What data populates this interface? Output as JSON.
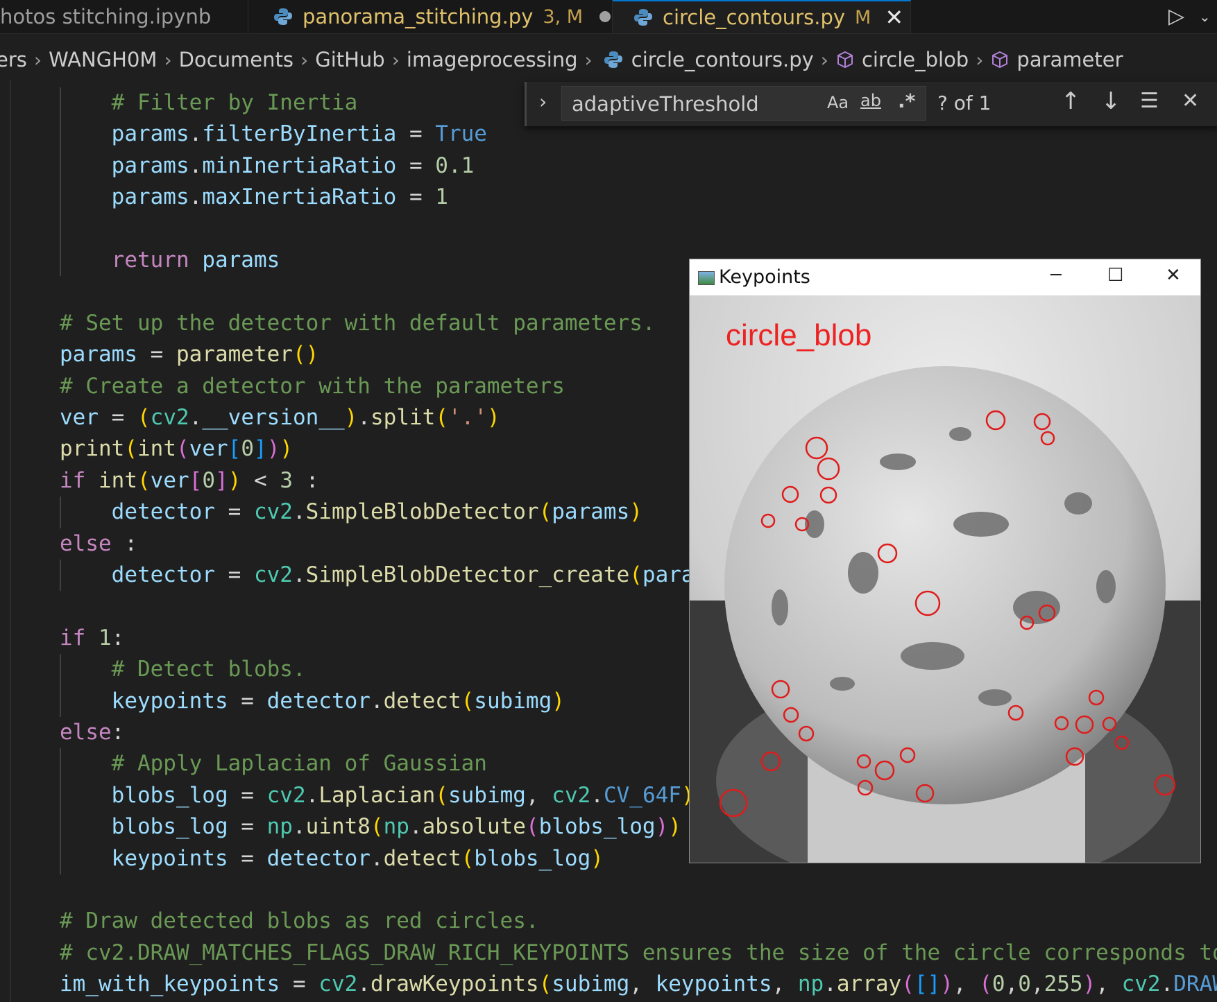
{
  "tabs": [
    {
      "label": "hotos stitching.ipynb"
    },
    {
      "label": "panorama_stitching.py",
      "status": "3, M"
    },
    {
      "label": "circle_contours.py",
      "status": "M"
    }
  ],
  "breadcrumb": {
    "items": [
      "ers",
      "WANGH0M",
      "Documents",
      "GitHub",
      "imageprocessing",
      "circle_contours.py",
      "circle_blob",
      "parameter"
    ]
  },
  "find_widget": {
    "query": "adaptiveThreshold",
    "match_case": "Aa",
    "whole_word": "ab",
    "regex": ".*",
    "result_count": "? of 1"
  },
  "code_lines": [
    "    # Filter by Inertia",
    "    params.filterByInertia = True",
    "    params.minInertiaRatio = 0.1",
    "    params.maxInertiaRatio = 1",
    "",
    "    return params",
    "",
    "# Set up the detector with default parameters.",
    "params = parameter()",
    "# Create a detector with the parameters",
    "ver = (cv2.__version__).split('.')",
    "print(int(ver[0]))",
    "if int(ver[0]) < 3 :",
    "    detector = cv2.SimpleBlobDetector(params)",
    "else :",
    "    detector = cv2.SimpleBlobDetector_create(para",
    "",
    "if 1:",
    "    # Detect blobs.",
    "    keypoints = detector.detect(subimg)",
    "else:",
    "    # Apply Laplacian of Gaussian",
    "    blobs_log = cv2.Laplacian(subimg, cv2.CV_64F)",
    "    blobs_log = np.uint8(np.absolute(blobs_log))",
    "    keypoints = detector.detect(blobs_log)",
    "",
    "# Draw detected blobs as red circles.",
    "# cv2.DRAW_MATCHES_FLAGS_DRAW_RICH_KEYPOINTS ensures the size of the circle corresponds to",
    "im_with_keypoints = cv2.drawKeypoints(subimg, keypoints, np.array([]), (0,0,255), cv2.DRAW"
  ],
  "image_window": {
    "title": "Keypoints",
    "overlay_text": "circle_blob",
    "minimize": "─",
    "maximize": "☐",
    "close": "✕"
  },
  "colors": {
    "editor_bg": "#1f1f1f",
    "keyword": "#c586c0",
    "variable": "#9cdcfe",
    "function": "#dcdcaa",
    "class": "#4ec9b0",
    "number": "#b5cea8",
    "comment": "#6a9955",
    "keypoint_circle": "#ff0000"
  },
  "icons": {
    "run": "play-icon",
    "close": "close-icon",
    "python": "python-icon",
    "symbol": "cube-icon"
  }
}
